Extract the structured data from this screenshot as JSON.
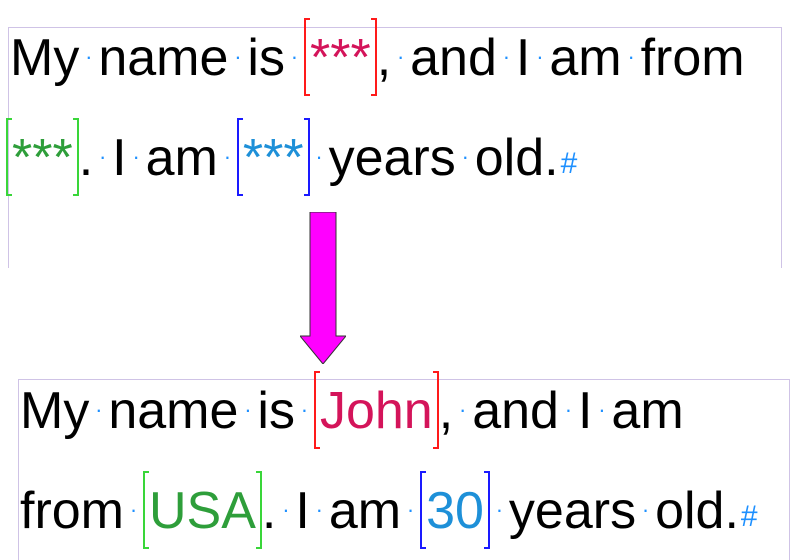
{
  "top": {
    "line1": {
      "my": "My",
      "name": "name",
      "is": "is",
      "field_name": "***",
      "after_field": ",",
      "and": "and",
      "i": "I",
      "am": "am",
      "from": "from"
    },
    "line2": {
      "field_country": "***",
      "period1": ".",
      "i": "I",
      "am": "am",
      "field_age": "***",
      "years": "years",
      "old": "old.",
      "end_mark": "#"
    }
  },
  "bottom": {
    "line1": {
      "my": "My",
      "name": "name",
      "is": "is",
      "field_name": "John",
      "after_field": ",",
      "and": "and",
      "i": "I",
      "am": "am"
    },
    "line2": {
      "from": "from",
      "field_country": "USA",
      "period1": ".",
      "i": "I",
      "am": "am",
      "field_age": "30",
      "years": "years",
      "old": "old.",
      "end_mark": "#"
    }
  },
  "colors": {
    "name_field": "#d4145a",
    "country_field": "#2e9e3a",
    "age_field": "#1e90d8",
    "name_bracket": "#ff1a1a",
    "country_bracket": "#39d639",
    "age_bracket": "#1a1aff",
    "arrow": "#ff00ff",
    "marks": "#1e90ff"
  }
}
